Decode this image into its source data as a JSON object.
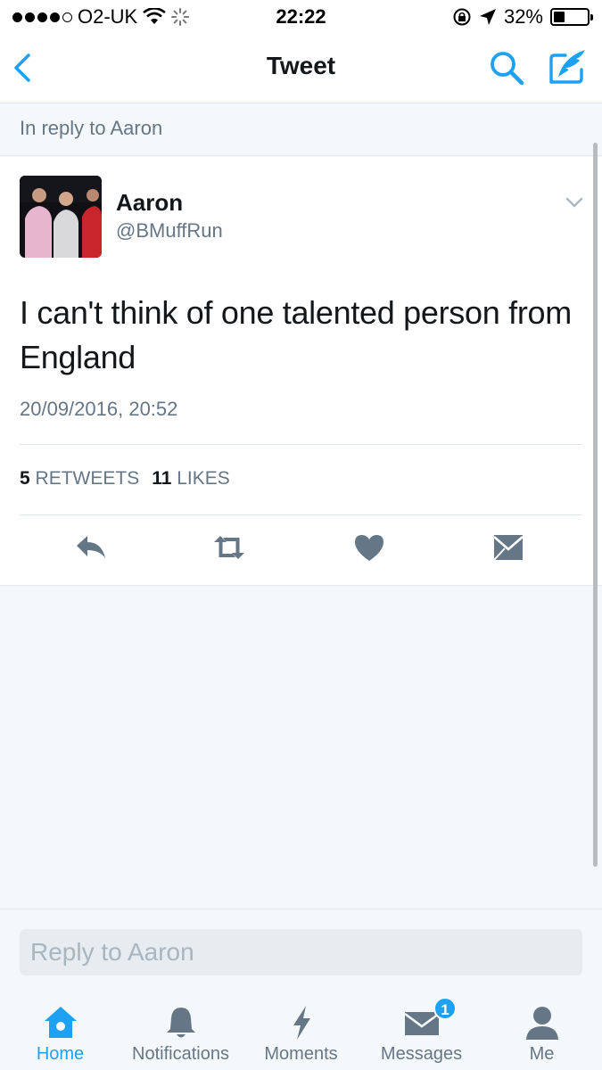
{
  "status_bar": {
    "carrier": "O2-UK",
    "time": "22:22",
    "battery_percent": "32%",
    "battery_level": 0.32
  },
  "nav": {
    "title": "Tweet"
  },
  "reply_context": "In reply to Aaron",
  "tweet": {
    "author_name": "Aaron",
    "author_handle": "@BMuffRun",
    "text": "I can't think of one talented person from England",
    "timestamp": "20/09/2016, 20:52",
    "retweet_count": "5",
    "retweet_label": "RETWEETS",
    "like_count": "11",
    "like_label": "LIKES"
  },
  "reply_box": {
    "placeholder": "Reply to Aaron"
  },
  "tabs": [
    {
      "label": "Home",
      "icon": "home-icon",
      "active": true
    },
    {
      "label": "Notifications",
      "icon": "bell-icon"
    },
    {
      "label": "Moments",
      "icon": "lightning-icon"
    },
    {
      "label": "Messages",
      "icon": "envelope-icon",
      "badge": "1"
    },
    {
      "label": "Me",
      "icon": "person-icon"
    }
  ],
  "colors": {
    "accent": "#1da1f2",
    "muted": "#657786",
    "background": "#f5f8fa",
    "text": "#14171a"
  }
}
